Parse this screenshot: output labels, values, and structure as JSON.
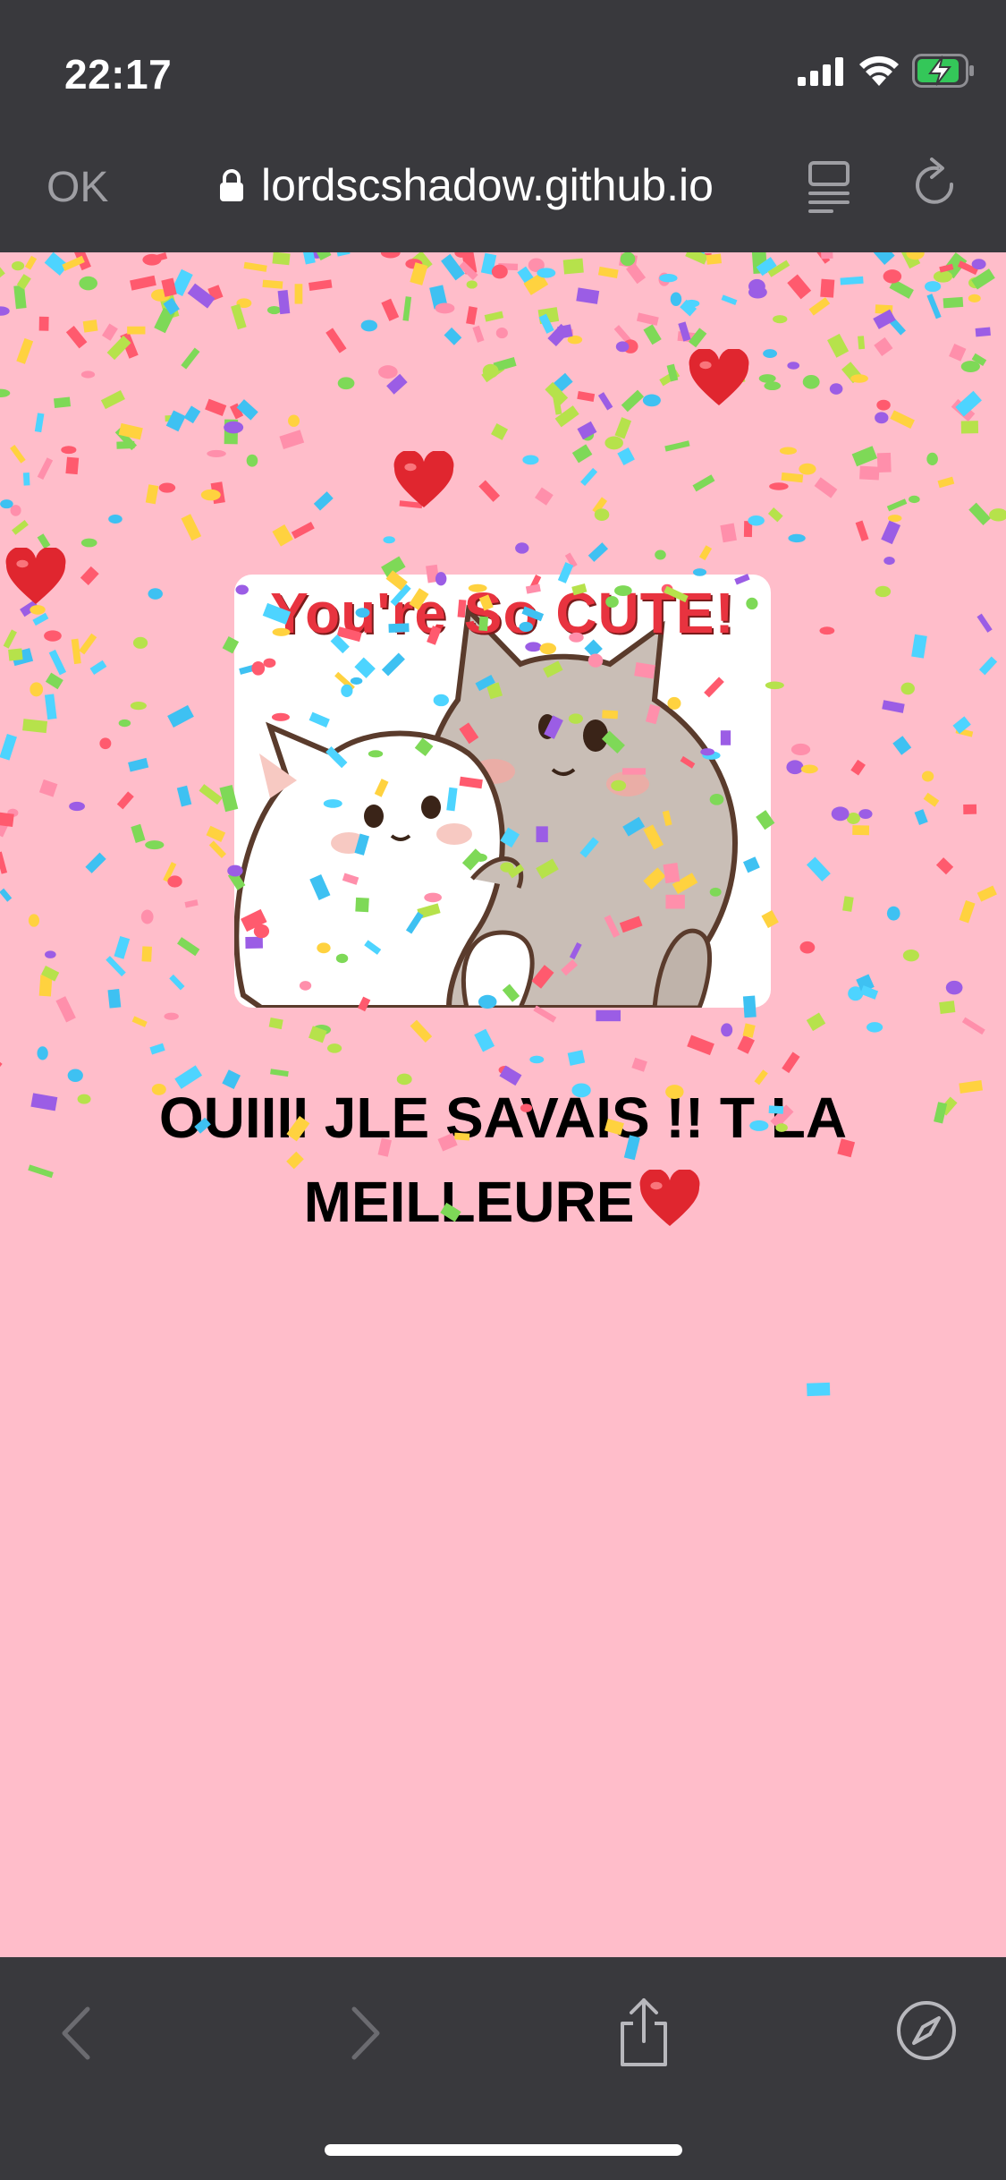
{
  "status_bar": {
    "time": "22:17",
    "battery_color": "#34c759"
  },
  "browser": {
    "done_label": "OK",
    "url": "lordscshadow.github.io"
  },
  "sticker": {
    "title": "You're So CUTE!"
  },
  "message": {
    "text": "OUIIII JLE SAVAIS !! T LA MEILLEURE"
  },
  "toolbar": {
    "back_icon": "chevron-left-icon",
    "forward_icon": "chevron-right-icon",
    "share_icon": "share-icon",
    "safari_icon": "compass-icon"
  },
  "colors": {
    "background": "#ffbdca",
    "chrome": "#39393d",
    "heart": "#e0262f"
  }
}
